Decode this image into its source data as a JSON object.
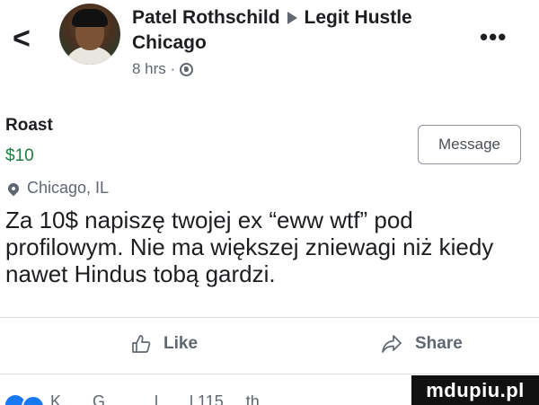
{
  "header": {
    "author": "Patel Rothschild",
    "group_line1": "Legit Hustle",
    "group_line2": "Chicago",
    "time": "8 hrs ·",
    "back_glyph": "<",
    "more_glyph": "•••"
  },
  "listing": {
    "title": "Roast",
    "price": "$10",
    "location": "Chicago, IL",
    "message_button": "Message"
  },
  "post": {
    "body": "Za 10$ napiszę twojej ex “eww wtf” pod profilowym. Nie ma większej zniewagi niż kiedy nawet Hindus tobą gardzi."
  },
  "actions": {
    "like": "Like",
    "share": "Share"
  },
  "reactions": {
    "text": "K . . . G . . . . . l . . . l 115 . . th . . ."
  },
  "watermark": {
    "text": "mdupiu.pl"
  },
  "icons": [
    "back-chevron-icon",
    "more-dots-icon",
    "globe-icon",
    "location-pin-icon",
    "like-thumb-icon",
    "share-arrow-icon"
  ],
  "colors": {
    "price_green": "#1c7f3f",
    "secondary_text": "#606770",
    "divider": "#dadde1"
  }
}
